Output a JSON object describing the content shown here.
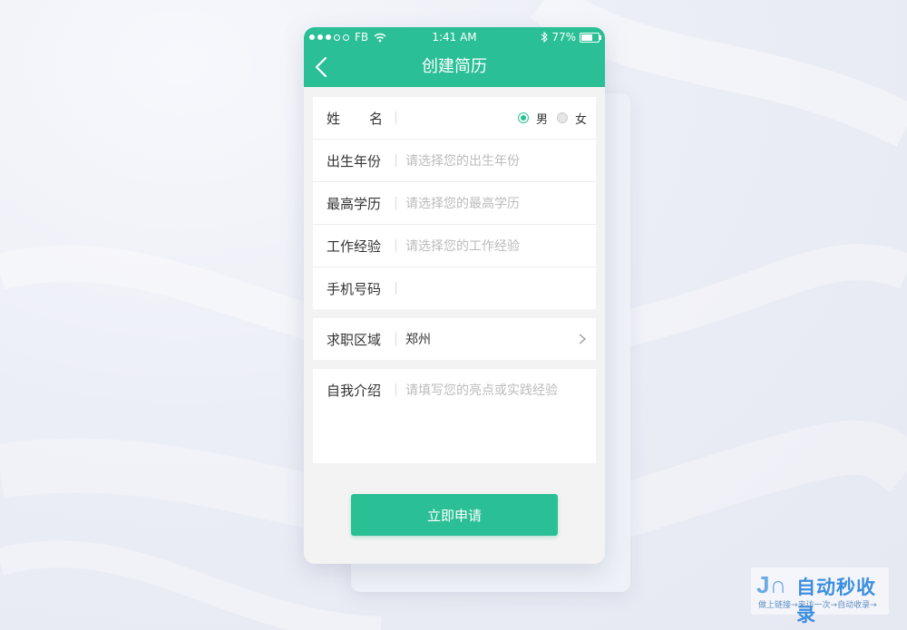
{
  "status_bar": {
    "carrier": "FB",
    "time": "1:41 AM",
    "battery": "77%",
    "battery_level": 0.77
  },
  "nav": {
    "title": "创建简历",
    "back_icon": "chevron-left-icon"
  },
  "form": {
    "name": {
      "label_left": "姓",
      "label_right": "名",
      "value": "",
      "gender_male": "男",
      "gender_female": "女",
      "selected_gender": "男"
    },
    "birth_year": {
      "label": "出生年份",
      "placeholder": "请选择您的出生年份"
    },
    "education": {
      "label": "最高学历",
      "placeholder": "请选择您的最高学历"
    },
    "experience": {
      "label": "工作经验",
      "placeholder": "请选择您的工作经验"
    },
    "phone": {
      "label": "手机号码",
      "value": ""
    },
    "region": {
      "label": "求职区域",
      "value": "郑州"
    },
    "intro": {
      "label": "自我介绍",
      "placeholder": "请填写您的亮点或实践经验"
    }
  },
  "submit_label": "立即申请",
  "watermark": {
    "logo": "J∩",
    "main": "自动秒收录",
    "sub": "做上链接→来访一次→自动收录→"
  },
  "colors": {
    "accent": "#2bbf96",
    "background": "#eceef6"
  }
}
